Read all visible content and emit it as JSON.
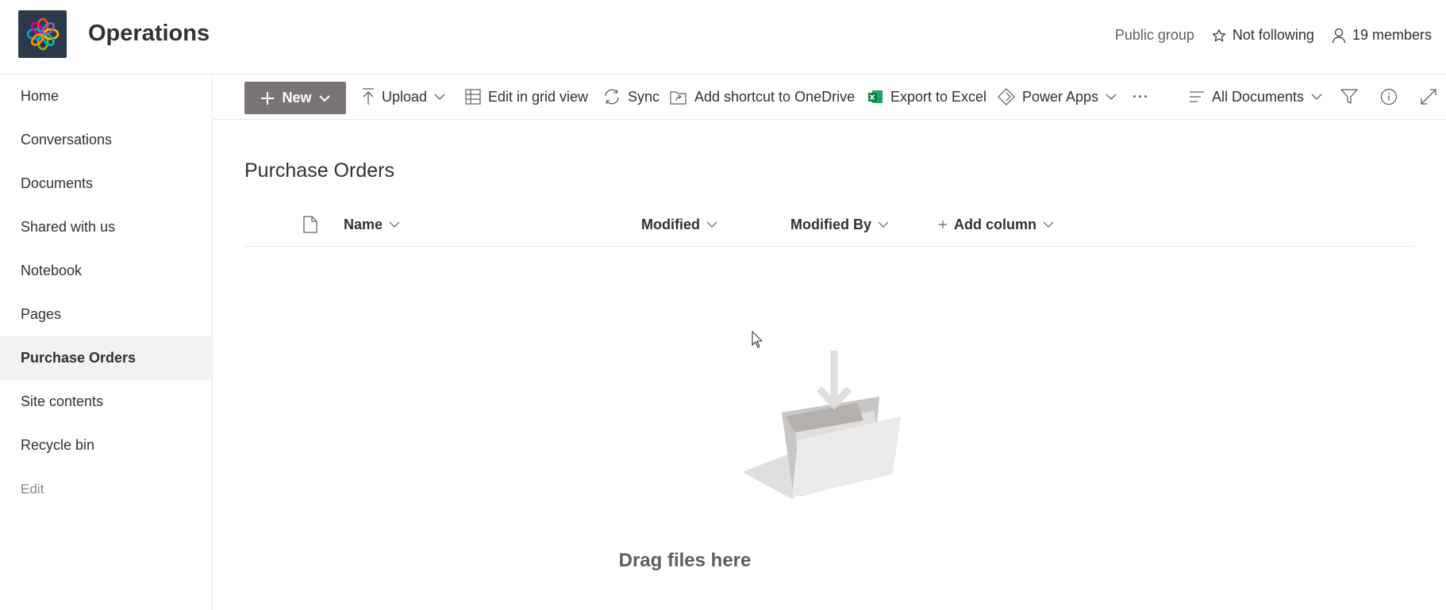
{
  "header": {
    "title": "Operations",
    "privacy": "Public group",
    "follow": "Not following",
    "members": "19 members"
  },
  "nav": {
    "items": [
      {
        "label": "Home"
      },
      {
        "label": "Conversations"
      },
      {
        "label": "Documents"
      },
      {
        "label": "Shared with us"
      },
      {
        "label": "Notebook"
      },
      {
        "label": "Pages"
      },
      {
        "label": "Purchase Orders",
        "selected": true
      },
      {
        "label": "Site contents"
      },
      {
        "label": "Recycle bin"
      }
    ],
    "edit": "Edit"
  },
  "commands": {
    "new": "New",
    "upload": "Upload",
    "grid": "Edit in grid view",
    "sync": "Sync",
    "shortcut": "Add shortcut to OneDrive",
    "excel": "Export to Excel",
    "powerapps": "Power Apps",
    "more": "···",
    "view": "All Documents"
  },
  "library": {
    "title": "Purchase Orders",
    "columns": {
      "name": "Name",
      "modified": "Modified",
      "modified_by": "Modified By",
      "add_column": "Add column"
    },
    "empty_text": "Drag files here"
  },
  "colors": {
    "new_button": "#7a7574",
    "logo_bg": "#2b3a4a",
    "excel_green": "#107c41",
    "selected_nav": "#f3f2f1"
  }
}
